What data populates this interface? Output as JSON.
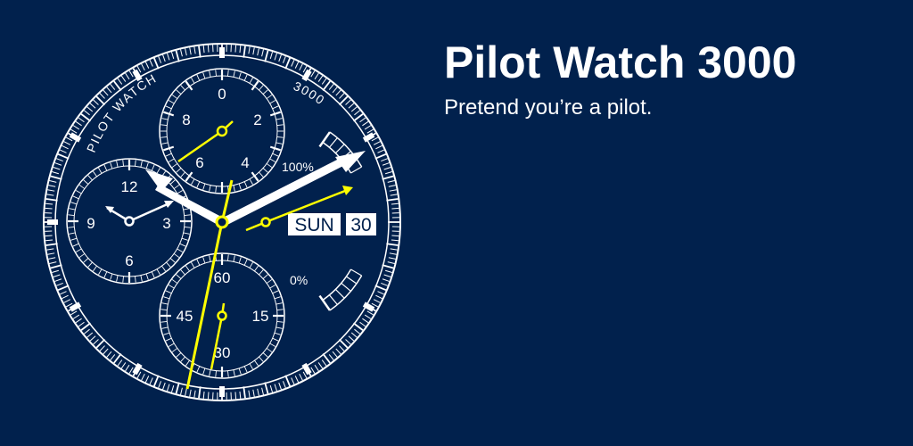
{
  "promo": {
    "title": "Pilot Watch 3000",
    "tagline": "Pretend you’re a pilot."
  },
  "watch": {
    "arc_text_left": "PILOT WATCH",
    "arc_text_right": "3000",
    "day": "SUN",
    "date": "30",
    "gauge_max_label": "100%",
    "gauge_min_label": "0%",
    "subdial_top_labels": [
      "0",
      "2",
      "4",
      "6",
      "8"
    ],
    "subdial_left_labels": [
      "12",
      "3",
      "6",
      "9"
    ],
    "subdial_bottom_labels": [
      "60",
      "15",
      "30",
      "45"
    ],
    "colors": {
      "background": "#01214d",
      "hands_white": "#ffffff",
      "hands_yellow": "#ffff00",
      "markings": "#ffffff"
    }
  }
}
